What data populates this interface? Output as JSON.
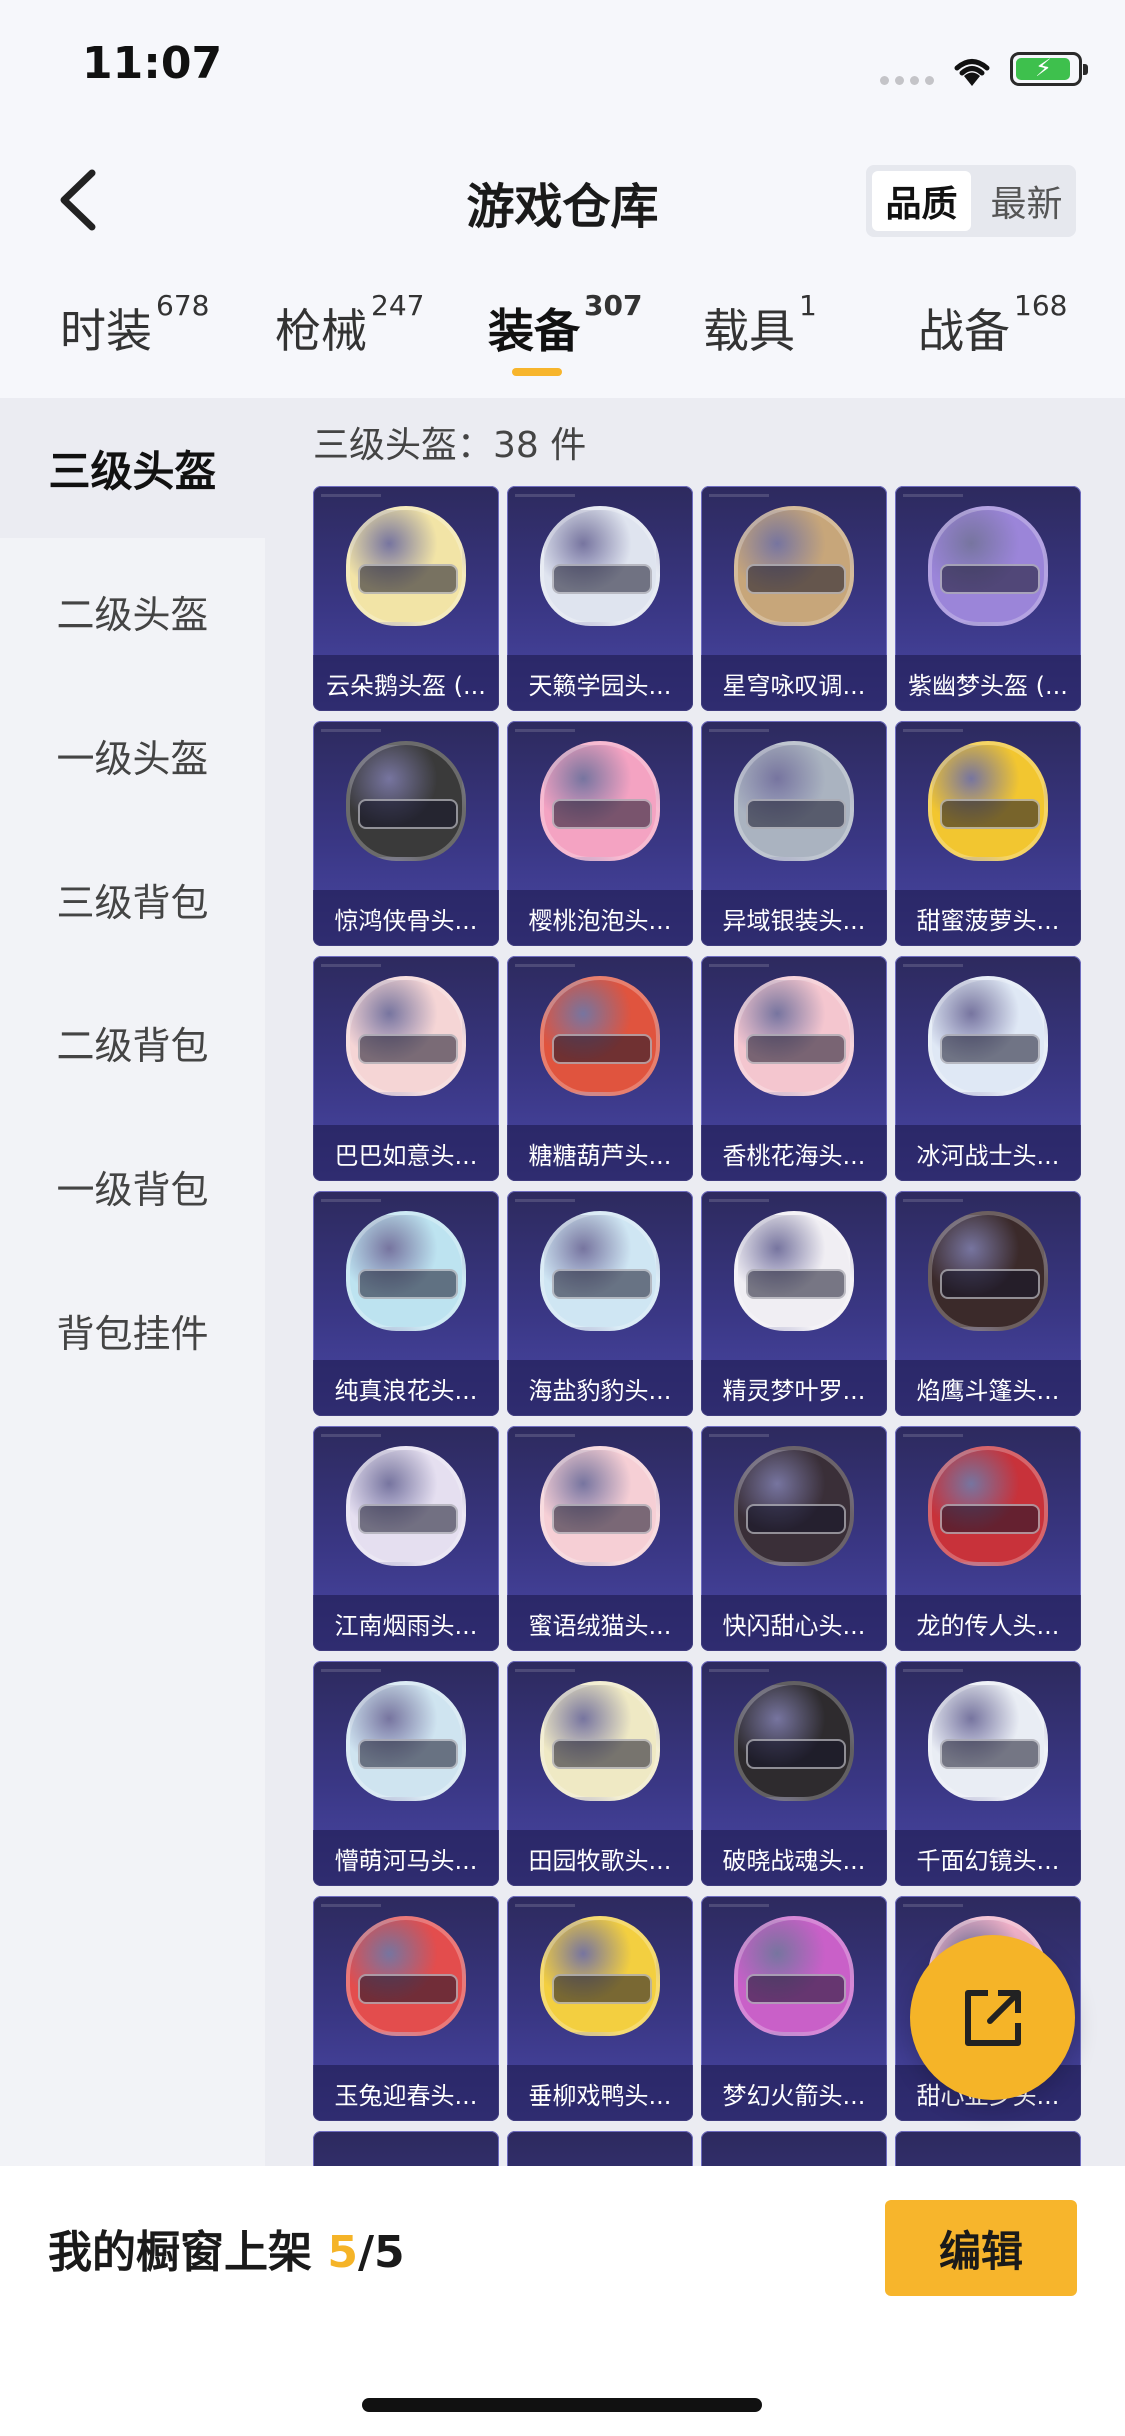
{
  "status_bar": {
    "time": "11:07"
  },
  "header": {
    "title": "游戏仓库",
    "sort_options": [
      "品质",
      "最新"
    ],
    "active_sort": "品质"
  },
  "tabs": [
    {
      "label": "时装",
      "count": "678"
    },
    {
      "label": "枪械",
      "count": "247"
    },
    {
      "label": "装备",
      "count": "307",
      "active": true
    },
    {
      "label": "载具",
      "count": "1"
    },
    {
      "label": "战备",
      "count": "168"
    }
  ],
  "sidebar": {
    "items": [
      {
        "label": "三级头盔",
        "active": true
      },
      {
        "label": "二级头盔"
      },
      {
        "label": "一级头盔"
      },
      {
        "label": "三级背包"
      },
      {
        "label": "二级背包"
      },
      {
        "label": "一级背包"
      },
      {
        "label": "背包挂件"
      }
    ]
  },
  "content": {
    "section_label": "三级头盔：38 件",
    "items": [
      {
        "name": "云朵鹅头盔 (...",
        "color": "#f2e4a6"
      },
      {
        "name": "天籁学园头...",
        "color": "#dfe4ef"
      },
      {
        "name": "星穹咏叹调...",
        "color": "#c7a67a"
      },
      {
        "name": "紫幽梦头盔 (...",
        "color": "#9b85d9"
      },
      {
        "name": "惊鸿侠骨头...",
        "color": "#3a3a3a"
      },
      {
        "name": "樱桃泡泡头...",
        "color": "#f4a3c2"
      },
      {
        "name": "异域银装头...",
        "color": "#aab3c0"
      },
      {
        "name": "甜蜜菠萝头...",
        "color": "#f2c630"
      },
      {
        "name": "巴巴如意头...",
        "color": "#f5d5d5"
      },
      {
        "name": "糖糖葫芦头...",
        "color": "#e0543e"
      },
      {
        "name": "香桃花海头...",
        "color": "#f4c6cf"
      },
      {
        "name": "冰河战士头...",
        "color": "#dfe8f5"
      },
      {
        "name": "纯真浪花头...",
        "color": "#bde3f0"
      },
      {
        "name": "海盐豹豹头...",
        "color": "#cfe6f3"
      },
      {
        "name": "精灵梦叶罗...",
        "color": "#f0eef3"
      },
      {
        "name": "焰鹰斗篷头...",
        "color": "#3b2a2a"
      },
      {
        "name": "江南烟雨头...",
        "color": "#e5dff0"
      },
      {
        "name": "蜜语绒猫头...",
        "color": "#f6cfd5"
      },
      {
        "name": "快闪甜心头...",
        "color": "#3a2f38"
      },
      {
        "name": "龙的传人头...",
        "color": "#c8323a"
      },
      {
        "name": "懵萌河马头...",
        "color": "#cfe4f0"
      },
      {
        "name": "田园牧歌头...",
        "color": "#efe9c4"
      },
      {
        "name": "破晓战魂头...",
        "color": "#2e2b2e"
      },
      {
        "name": "千面幻镜头...",
        "color": "#e9edf4"
      },
      {
        "name": "玉兔迎春头...",
        "color": "#e34d4d"
      },
      {
        "name": "垂柳戏鸭头...",
        "color": "#f3cf40"
      },
      {
        "name": "梦幻火箭头...",
        "color": "#c960c8"
      },
      {
        "name": "甜心亚乡头...",
        "color": "#f1b2c9"
      }
    ]
  },
  "bottom_bar": {
    "shelf_label": "我的橱窗上架",
    "shelf_current": "5",
    "shelf_total": "/5",
    "edit_label": "编辑"
  },
  "colors": {
    "accent": "#f7b52c",
    "card_bg": "#3a3785"
  }
}
